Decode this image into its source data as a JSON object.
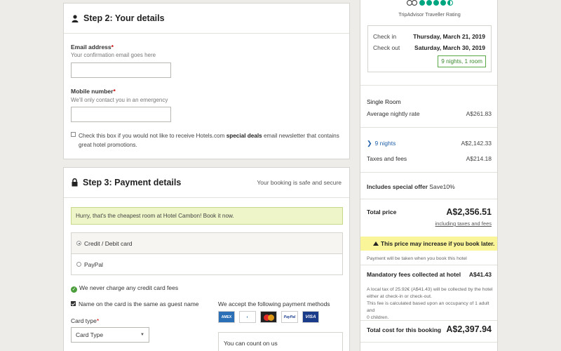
{
  "step2": {
    "title": "Step 2: Your details",
    "email_label": "Email address",
    "email_required": "*",
    "email_hint": "Your confirmation email goes here",
    "email_value": "",
    "mobile_label": "Mobile number",
    "mobile_required": "*",
    "mobile_hint": "We'll only contact you in an emergency",
    "mobile_value": "",
    "newsletter_prefix": "Check this box if you would not like to receive Hotels.com",
    "newsletter_bold": "special deals",
    "newsletter_suffix": "email newsletter that contains great hotel promotions."
  },
  "step3": {
    "title": "Step 3: Payment details",
    "secure_text": "Your booking is safe and secure",
    "alert": "Hurry, that's the cheapest room at Hotel Cambon! Book it now.",
    "options": [
      {
        "label": "Credit / Debit card",
        "selected": true
      },
      {
        "label": "PayPal",
        "selected": false
      }
    ],
    "no_charge": "We never charge any credit card fees",
    "name_same": "Name on the card is the same as guest name",
    "card_type_label": "Card type",
    "card_type_required": "*",
    "card_type_value": "Card Type",
    "accept_title": "We accept the following payment methods",
    "payment_methods": [
      "AMEX",
      "Diners Club",
      "MasterCard",
      "PayPal",
      "VISA"
    ],
    "count_on": "You can count on us"
  },
  "summary": {
    "rating_label": "TripAdvisor Traveller Rating",
    "rating": 4.5,
    "checkin_label": "Check in",
    "checkin_value": "Thursday, March 21, 2019",
    "checkout_label": "Check out",
    "checkout_value": "Saturday, March 30, 2019",
    "nights_rooms": "9 nights, 1 room",
    "room_type": "Single Room",
    "avg_label": "Average nightly rate",
    "avg_value": "A$261.83",
    "nights_label": "9 nights",
    "nights_value": "A$2,142.33",
    "taxes_label": "Taxes and fees",
    "taxes_value": "A$214.18",
    "offer_prefix": "Includes special offer",
    "offer_value": "Save10%",
    "total_label": "Total price",
    "total_value": "A$2,356.51",
    "incl_taxes": "including taxes and fees",
    "warning": "This price may increase if you book later.",
    "pay_note": "Payment will be taken when you book this hotel",
    "mandatory_label": "Mandatory fees collected at hotel",
    "mandatory_value": "A$41.43",
    "local_tax_line1": "A local tax of 25.92€ (A$41.43) will be collected by the hotel",
    "local_tax_line2": "either at check-in or check-out.",
    "occupancy_line1": "This fee is calculated based upon an occupancy of 1 adult and",
    "occupancy_line2": "0 children.",
    "total_cost_label": "Total cost for this booking",
    "total_cost_value": "A$2,397.94"
  }
}
